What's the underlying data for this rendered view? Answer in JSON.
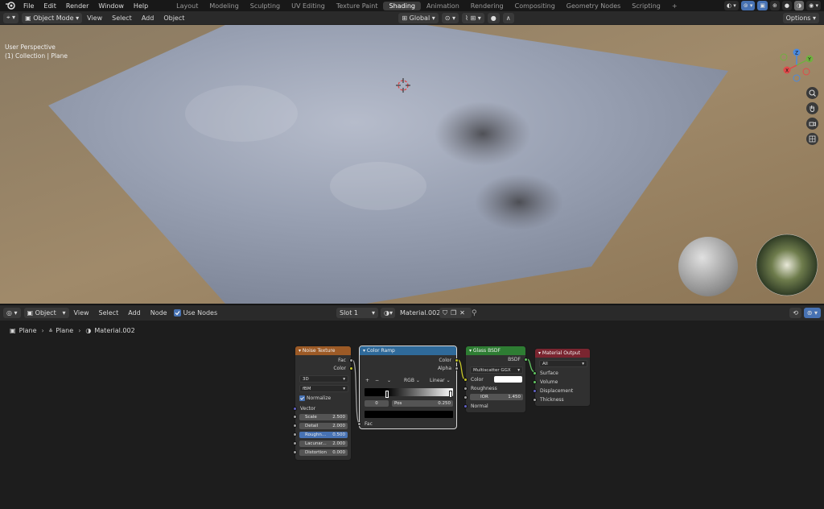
{
  "topbar": {
    "menus": [
      "File",
      "Edit",
      "Render",
      "Window",
      "Help"
    ],
    "workspaces": [
      "Layout",
      "Modeling",
      "Sculpting",
      "UV Editing",
      "Texture Paint",
      "Shading",
      "Animation",
      "Rendering",
      "Compositing",
      "Geometry Nodes",
      "Scripting",
      "+"
    ],
    "active_workspace": "Shading"
  },
  "viewport_header": {
    "mode": "Object Mode",
    "menus": [
      "View",
      "Select",
      "Add",
      "Object"
    ],
    "transform": "Global",
    "options": "Options"
  },
  "viewport": {
    "perspective": "User Perspective",
    "collection": "(1) Collection | Plane",
    "gizmo_axes": [
      "Z",
      "Y",
      "X"
    ]
  },
  "node_header": {
    "editor_mode": "Object",
    "menus": [
      "View",
      "Select",
      "Add",
      "Node"
    ],
    "use_nodes_label": "Use Nodes",
    "slot": "Slot 1",
    "material": "Material.002"
  },
  "breadcrumb": {
    "object": "Plane",
    "mesh": "Plane",
    "material": "Material.002"
  },
  "nodes": {
    "noise": {
      "title": "Noise Texture",
      "out_fac": "Fac",
      "out_color": "Color",
      "dims": "3D",
      "type": "fBM",
      "normalize": "Normalize",
      "vector": "Vector",
      "fields": [
        {
          "label": "Scale",
          "value": "2.500"
        },
        {
          "label": "Detail",
          "value": "2.000"
        },
        {
          "label": "Roughn...",
          "value": "0.500"
        },
        {
          "label": "Lacunar...",
          "value": "2.000"
        },
        {
          "label": "Distortion",
          "value": "0.000"
        }
      ]
    },
    "ramp": {
      "title": "Color Ramp",
      "out_color": "Color",
      "out_alpha": "Alpha",
      "mode": "RGB",
      "interp": "Linear",
      "add": "+",
      "remove": "−",
      "index": "0",
      "pos_label": "Pos",
      "pos_value": "0.250",
      "in_fac": "Fac"
    },
    "glass": {
      "title": "Glass BSDF",
      "out": "BSDF",
      "distribution": "Multiscatter GGX",
      "color": "Color",
      "roughness": "Roughness",
      "ior_label": "IOR",
      "ior_value": "1.450",
      "normal": "Normal"
    },
    "output": {
      "title": "Material Output",
      "target": "All",
      "surface": "Surface",
      "volume": "Volume",
      "displacement": "Displacement",
      "thickness": "Thickness"
    }
  },
  "colors": {
    "noise_header": "#9c5a26",
    "ramp_header": "#2f6a9a",
    "glass_header": "#2e7d33",
    "output_header": "#7a2530",
    "accent": "#4772b3"
  }
}
